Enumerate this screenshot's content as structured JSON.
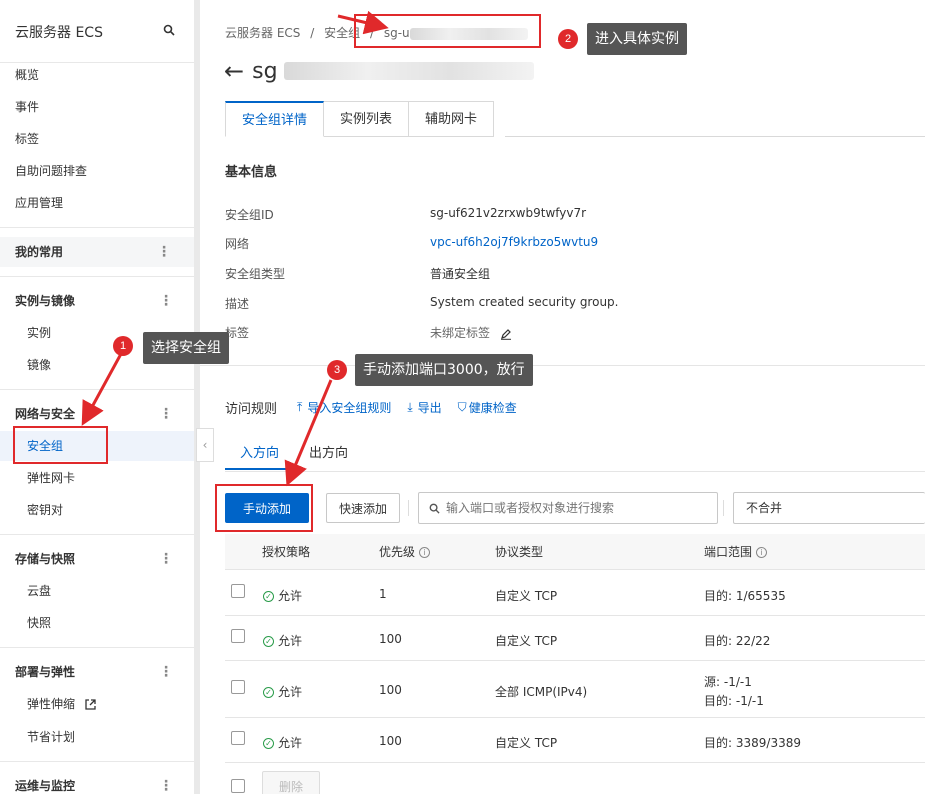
{
  "sidebar": {
    "title": "云服务器 ECS",
    "top_items": [
      "概览",
      "事件",
      "标签",
      "自助问题排查",
      "应用管理"
    ],
    "favorites_label": "我的常用",
    "groups": [
      {
        "label": "实例与镜像",
        "items": [
          "实例",
          "镜像"
        ]
      },
      {
        "label": "网络与安全",
        "items": [
          "安全组",
          "弹性网卡",
          "密钥对"
        ]
      },
      {
        "label": "存储与快照",
        "items": [
          "云盘",
          "快照"
        ]
      },
      {
        "label": "部署与弹性",
        "items": [
          "弹性伸缩",
          "节省计划"
        ]
      },
      {
        "label": "运维与监控",
        "items": []
      }
    ]
  },
  "breadcrumb": [
    "云服务器 ECS",
    "/",
    "安全组",
    "/",
    "sg-u"
  ],
  "page_title": "sg",
  "tabs": [
    "安全组详情",
    "实例列表",
    "辅助网卡"
  ],
  "basic_info": {
    "title": "基本信息",
    "rows": [
      {
        "label": "安全组ID",
        "value": "sg-uf621v2zrxwb9twfyv7r"
      },
      {
        "label": "网络",
        "value": "vpc-uf6h2oj7f9krbzo5wvtu9"
      },
      {
        "label": "安全组类型",
        "value": "普通安全组"
      },
      {
        "label": "描述",
        "value": "System created security group."
      },
      {
        "label": "标签",
        "value": "未绑定标签"
      }
    ]
  },
  "rules": {
    "title": "访问规则",
    "links": [
      "导入安全组规则",
      "导出",
      "健康检查"
    ],
    "directions": [
      "入方向",
      "出方向"
    ],
    "add_button": "手动添加",
    "quick_add_button": "快速添加",
    "search_placeholder": "输入端口或者授权对象进行搜索",
    "merge_select": "不合并",
    "columns": [
      "授权策略",
      "优先级",
      "协议类型",
      "端口范围"
    ],
    "rows": [
      {
        "policy": "允许",
        "priority": "1",
        "protocol": "自定义 TCP",
        "port": [
          "目的: 1/65535"
        ]
      },
      {
        "policy": "允许",
        "priority": "100",
        "protocol": "自定义 TCP",
        "port": [
          "目的: 22/22"
        ]
      },
      {
        "policy": "允许",
        "priority": "100",
        "protocol": "全部 ICMP(IPv4)",
        "port": [
          "源: -1/-1",
          "目的: -1/-1"
        ]
      },
      {
        "policy": "允许",
        "priority": "100",
        "protocol": "自定义 TCP",
        "port": [
          "目的: 3389/3389"
        ]
      }
    ],
    "delete_button": "删除"
  },
  "annotations": [
    {
      "num": "1",
      "text": "选择安全组"
    },
    {
      "num": "2",
      "text": "进入具体实例"
    },
    {
      "num": "3",
      "text": "手动添加端口3000，放行"
    }
  ],
  "colors": {
    "accent": "#0064c8",
    "annotation": "#e0292b",
    "callout_bg": "#555555",
    "allow": "#2a9c4a"
  }
}
